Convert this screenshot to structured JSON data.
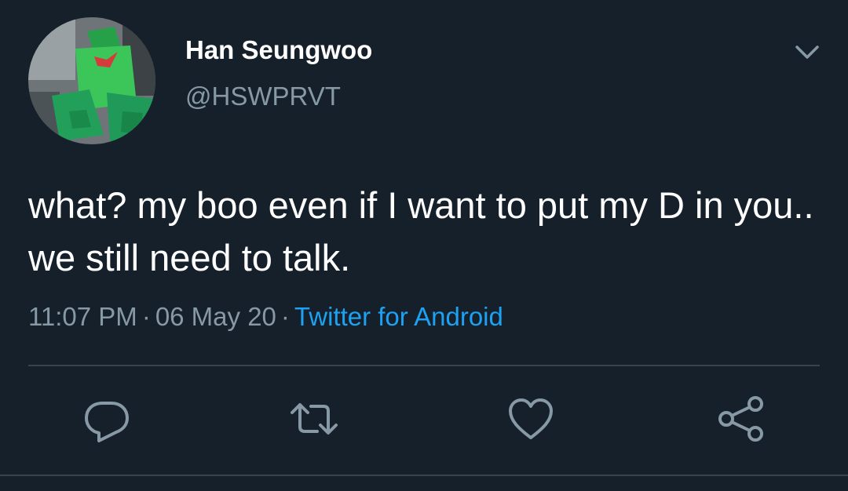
{
  "tweet": {
    "author": {
      "display_name": "Han Seungwoo",
      "handle": "@HSWPRVT",
      "avatar_icon": "profile-photo-green-costume"
    },
    "text": "what? my boo even if I want to put my D in you.. we still need to talk.",
    "time": "11:07 PM",
    "date": "06 May 20",
    "separator": "·",
    "source": "Twitter for Android"
  },
  "actions": {
    "reply_icon": "reply-icon",
    "retweet_icon": "retweet-icon",
    "like_icon": "heart-icon",
    "share_icon": "share-icon"
  },
  "colors": {
    "background": "#15202b",
    "primary_text": "#ffffff",
    "secondary_text": "#8899a6",
    "link": "#1da1f2",
    "divider": "#38444d"
  }
}
